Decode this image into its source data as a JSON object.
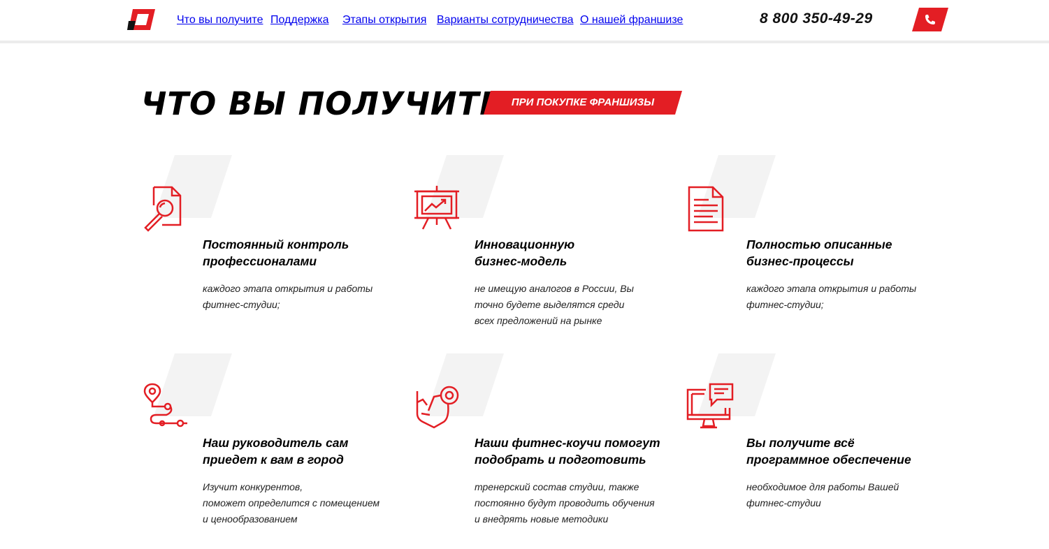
{
  "header": {
    "nav": [
      {
        "label": "Что вы получите"
      },
      {
        "label": "Поддержка"
      },
      {
        "label": "Этапы открытия"
      },
      {
        "label": "Варианты сотрудничества"
      },
      {
        "label": "О нашей франшизе"
      }
    ],
    "phone": "8 800 350-49-29",
    "call_icon": "phone-icon"
  },
  "section": {
    "title": "ЧТО ВЫ ПОЛУЧИТЕ",
    "badge": "ПРИ ПОКУПКЕ ФРАНШИЗЫ"
  },
  "features": [
    {
      "icon": "document-search-icon",
      "title": "Постоянный контроль\nпрофессионалами",
      "desc": "каждого этапа открытия и работы\nфитнес-студии;"
    },
    {
      "icon": "presentation-chart-icon",
      "title": "Инновационную\nбизнес-модель",
      "desc": "не имещую аналогов в России, Вы\nточно будете выделятся среди\nвсех предложений на рынке"
    },
    {
      "icon": "document-icon",
      "title": "Полностью описанные\nбизнес-процессы",
      "desc": "каждого этапа открытия и работы\nфитнес-студии;"
    },
    {
      "icon": "route-pin-icon",
      "title": "Наш руководитель сам\nприедет к вам в город",
      "desc": "Изучит конкурентов,\nпоможет определится с помещением\nи ценообразованием"
    },
    {
      "icon": "coach-target-icon",
      "title": "Наши фитнес-коучи помогут\nподобрать и подготовить",
      "desc": "тренерский состав студии, также\nпостоянно будут проводить обучения\nи внедрять новые методики"
    },
    {
      "icon": "monitor-chat-icon",
      "title": "Вы получите всё\nпрограммное обеспечение",
      "desc": "необходимое для работы Вашей\nфитнес-студии"
    }
  ],
  "colors": {
    "accent": "#e31e24",
    "shape": "#f3f3f3"
  }
}
